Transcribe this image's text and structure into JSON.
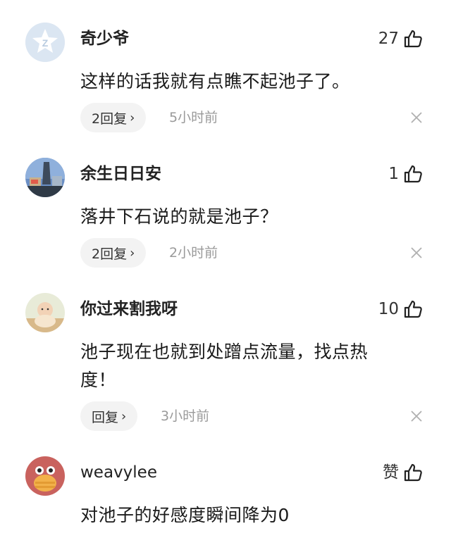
{
  "comments": [
    {
      "username": "奇少爷",
      "likes": "27",
      "text": "这样的话我就有点瞧不起池子了。",
      "reply_label": "2回复",
      "time": "5小时前",
      "avatar_icon": "qq-default-avatar-icon"
    },
    {
      "username": "余生日日安",
      "likes": "1",
      "text": "落井下石说的就是池子？",
      "reply_label": "2回复",
      "time": "2小时前",
      "avatar_icon": "city-photo-avatar"
    },
    {
      "username": "你过来割我呀",
      "likes": "10",
      "text_line1": "池子现在也就到处蹭点流量，找点热",
      "text_line2": "度！",
      "reply_label": "回复",
      "time": "3小时前",
      "avatar_icon": "baby-photo-avatar"
    },
    {
      "username": "weavylee",
      "likes": "赞",
      "text": "对池子的好感度瞬间降为0",
      "avatar_icon": "cartoon-avatar"
    }
  ],
  "icons": {
    "like": "thumbs-up-icon",
    "close": "close-icon",
    "chevron": "chevron-right-icon"
  },
  "colors": {
    "muted": "#9a9a9a",
    "pill_bg": "#f3f3f3"
  }
}
